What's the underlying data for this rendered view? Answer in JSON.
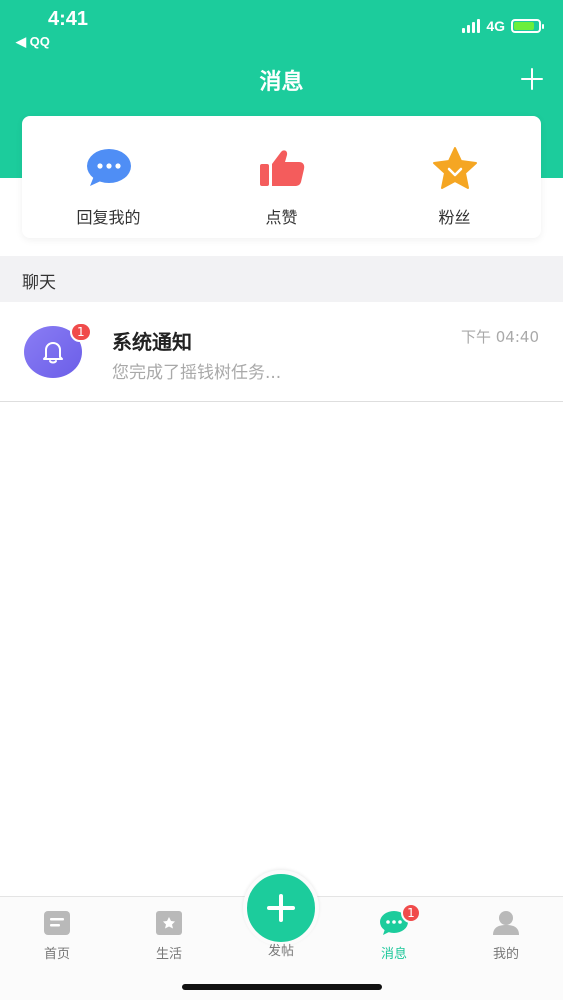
{
  "status": {
    "time": "4:41",
    "back_app": "◀ QQ",
    "network": "4G",
    "battery_level": 0.85
  },
  "header": {
    "title": "消息",
    "plus_icon": "plus-icon"
  },
  "quick_actions": [
    {
      "label": "回复我的",
      "icon": "chat-bubble-icon",
      "color": "#4f8ef5"
    },
    {
      "label": "点赞",
      "icon": "thumbs-up-icon",
      "color": "#f45c5c"
    },
    {
      "label": "粉丝",
      "icon": "star-icon",
      "color": "#f5a623"
    }
  ],
  "chat_section": {
    "title": "聊天"
  },
  "chats": [
    {
      "name": "系统通知",
      "preview": "您完成了摇钱树任务...",
      "time": "下午 04:40",
      "badge": "1",
      "icon": "bell-icon"
    }
  ],
  "tab_bar": {
    "tabs": [
      {
        "label": "首页",
        "icon": "home-doc-icon",
        "active": false
      },
      {
        "label": "生活",
        "icon": "life-bookmark-icon",
        "active": false
      },
      {
        "label": "发帖",
        "icon": "plus-icon",
        "active": false
      },
      {
        "label": "消息",
        "icon": "message-bubble-icon",
        "active": true,
        "badge": "1"
      },
      {
        "label": "我的",
        "icon": "user-icon",
        "active": false
      }
    ]
  },
  "colors": {
    "brand": "#1ccc9c",
    "badge": "#f04b4b",
    "muted_text": "#a9a9a9"
  }
}
